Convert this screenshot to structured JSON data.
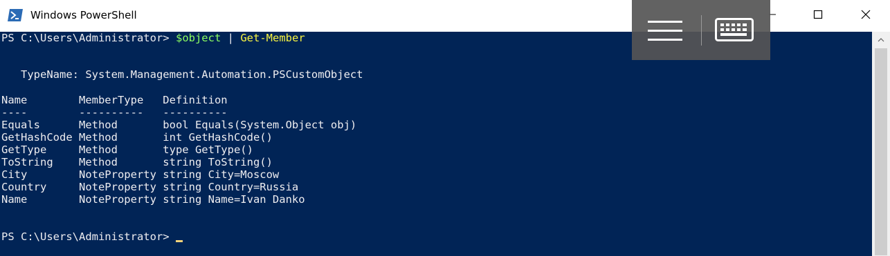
{
  "window": {
    "title": "Windows PowerShell",
    "icon": "powershell-icon",
    "controls": [
      "minimize-icon",
      "maximize-icon",
      "close-icon"
    ]
  },
  "overlay": {
    "icons": [
      "hamburger-menu-icon",
      "keyboard-icon"
    ]
  },
  "console": {
    "prompt": "PS C:\\Users\\Administrator>",
    "command": {
      "variable": "$object",
      "pipe": "|",
      "cmdlet": "Get-Member"
    },
    "typename_line": "   TypeName: System.Management.Automation.PSCustomObject",
    "table": {
      "header": "Name        MemberType   Definition",
      "separator": "----        ----------   ----------",
      "rows": [
        "Equals      Method       bool Equals(System.Object obj)",
        "GetHashCode Method       int GetHashCode()",
        "GetType     Method       type GetType()",
        "ToString    Method       string ToString()",
        "City        NoteProperty string City=Moscow",
        "Country     NoteProperty string Country=Russia",
        "Name        NoteProperty string Name=Ivan Danko"
      ]
    },
    "final_prompt": "PS C:\\Users\\Administrator>"
  },
  "colors": {
    "console_background": "#012456",
    "console_text": "#eeedf0",
    "variable": "#8dff61",
    "cmdlet": "#f8f442"
  }
}
